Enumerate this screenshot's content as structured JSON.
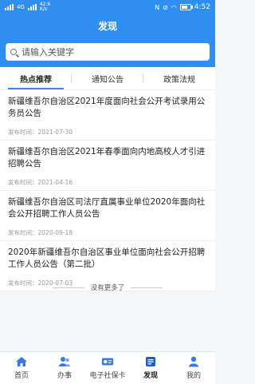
{
  "status_bar": {
    "network": "4G",
    "speed": "42.6",
    "speed_unit": "K/s",
    "time": "4:52"
  },
  "header": {
    "title": "发现"
  },
  "search": {
    "placeholder": "请输入关键字"
  },
  "tabs": [
    {
      "label": "热点推荐",
      "active": true
    },
    {
      "label": "通知公告",
      "active": false
    },
    {
      "label": "政策法规",
      "active": false
    }
  ],
  "date_prefix": "发布时间：",
  "articles": [
    {
      "title": "新疆维吾尔自治区2021年度面向社会公开考试录用公务员公告",
      "date": "2021-07-30"
    },
    {
      "title": "新疆维吾尔自治区2021年春季面向内地高校人才引进招聘公告",
      "date": "2021-04-16"
    },
    {
      "title": "新疆维吾尔自治区司法厅直属事业单位2020年面向社会公开招聘工作人员公告",
      "date": "2020-09-18"
    },
    {
      "title": "2020年新疆维吾尔自治区事业单位面向社会公开招聘工作人员公告（第二批）",
      "date": "2020-07-03"
    }
  ],
  "no_more_text": "没有更多了",
  "bottom_nav": [
    {
      "label": "首页",
      "icon": "home-icon"
    },
    {
      "label": "办事",
      "icon": "people-icon"
    },
    {
      "label": "电子社保卡",
      "icon": "card-icon"
    },
    {
      "label": "发现",
      "icon": "discover-icon",
      "active": true
    },
    {
      "label": "我的",
      "icon": "user-icon"
    }
  ],
  "colors": {
    "accent": "#2f8ff0"
  }
}
